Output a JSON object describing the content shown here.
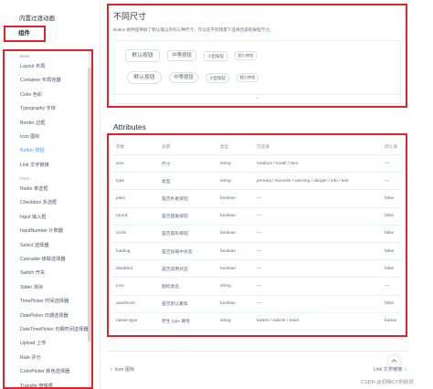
{
  "sidebar": {
    "top_item": "内置过渡动画",
    "section": "组件",
    "groups": [
      {
        "label": "Basic",
        "items": [
          {
            "label": "Layout 布局",
            "active": false
          },
          {
            "label": "Container 布局容器",
            "active": false
          },
          {
            "label": "Color 色彩",
            "active": false
          },
          {
            "label": "Typography 字体",
            "active": false
          },
          {
            "label": "Border 边框",
            "active": false
          },
          {
            "label": "Icon 图标",
            "active": false
          },
          {
            "label": "Button 按钮",
            "active": true
          },
          {
            "label": "Link 文字链接",
            "active": false
          }
        ]
      },
      {
        "label": "Form",
        "items": [
          {
            "label": "Radio 单选框",
            "active": false
          },
          {
            "label": "Checkbox 多选框",
            "active": false
          },
          {
            "label": "Input 输入框",
            "active": false
          },
          {
            "label": "InputNumber 计数器",
            "active": false
          },
          {
            "label": "Select 选择器",
            "active": false
          },
          {
            "label": "Cascader 级联选择器",
            "active": false
          },
          {
            "label": "Switch 开关",
            "active": false
          },
          {
            "label": "Slider 滑块",
            "active": false
          },
          {
            "label": "TimePicker 时间选择器",
            "active": false
          },
          {
            "label": "DatePicker 日期选择器",
            "active": false
          },
          {
            "label": "DateTimePicker 日期时间选择器",
            "active": false
          },
          {
            "label": "Upload 上传",
            "active": false
          },
          {
            "label": "Rate 评分",
            "active": false
          },
          {
            "label": "ColorPicker 颜色选择器",
            "active": false
          },
          {
            "label": "Transfer 穿梭框",
            "active": false
          }
        ]
      }
    ]
  },
  "section_sizes": {
    "title": "不同尺寸",
    "description": "Button 组件提供除了默认值以外的三种尺寸，可以在不同场景下选择合适的按钮尺寸。",
    "rows": [
      [
        "默认按钮",
        "中等按钮",
        "小型按钮",
        "超小按钮"
      ],
      [
        "默认按钮",
        "中等按钮",
        "小型按钮",
        "超小按钮"
      ]
    ]
  },
  "attributes": {
    "title": "Attributes",
    "columns": [
      "参数",
      "说明",
      "类型",
      "可选值",
      "默认值"
    ],
    "rows": [
      [
        "size",
        "尺寸",
        "string",
        "medium / small / mini",
        "—"
      ],
      [
        "type",
        "类型",
        "string",
        "primary / success / warning / danger / info / text",
        "—"
      ],
      [
        "plain",
        "是否朴素按钮",
        "boolean",
        "—",
        "false"
      ],
      [
        "round",
        "是否圆角按钮",
        "boolean",
        "—",
        "false"
      ],
      [
        "circle",
        "是否圆形按钮",
        "boolean",
        "—",
        "false"
      ],
      [
        "loading",
        "是否加载中状态",
        "boolean",
        "—",
        "false"
      ],
      [
        "disabled",
        "是否禁用状态",
        "boolean",
        "—",
        "false"
      ],
      [
        "icon",
        "图标类名",
        "string",
        "—",
        "—"
      ],
      [
        "autofocus",
        "是否默认聚焦",
        "boolean",
        "—",
        "false"
      ],
      [
        "native-type",
        "原生 type 属性",
        "string",
        "button / submit / reset",
        "button"
      ]
    ]
  },
  "pager": {
    "prev": "Icon 图标",
    "next": "Link 文字链接"
  },
  "watermark": "CSDN @初映CY的前说",
  "colors": {
    "highlight_border": "#e0242e",
    "active_link": "#409eff"
  }
}
